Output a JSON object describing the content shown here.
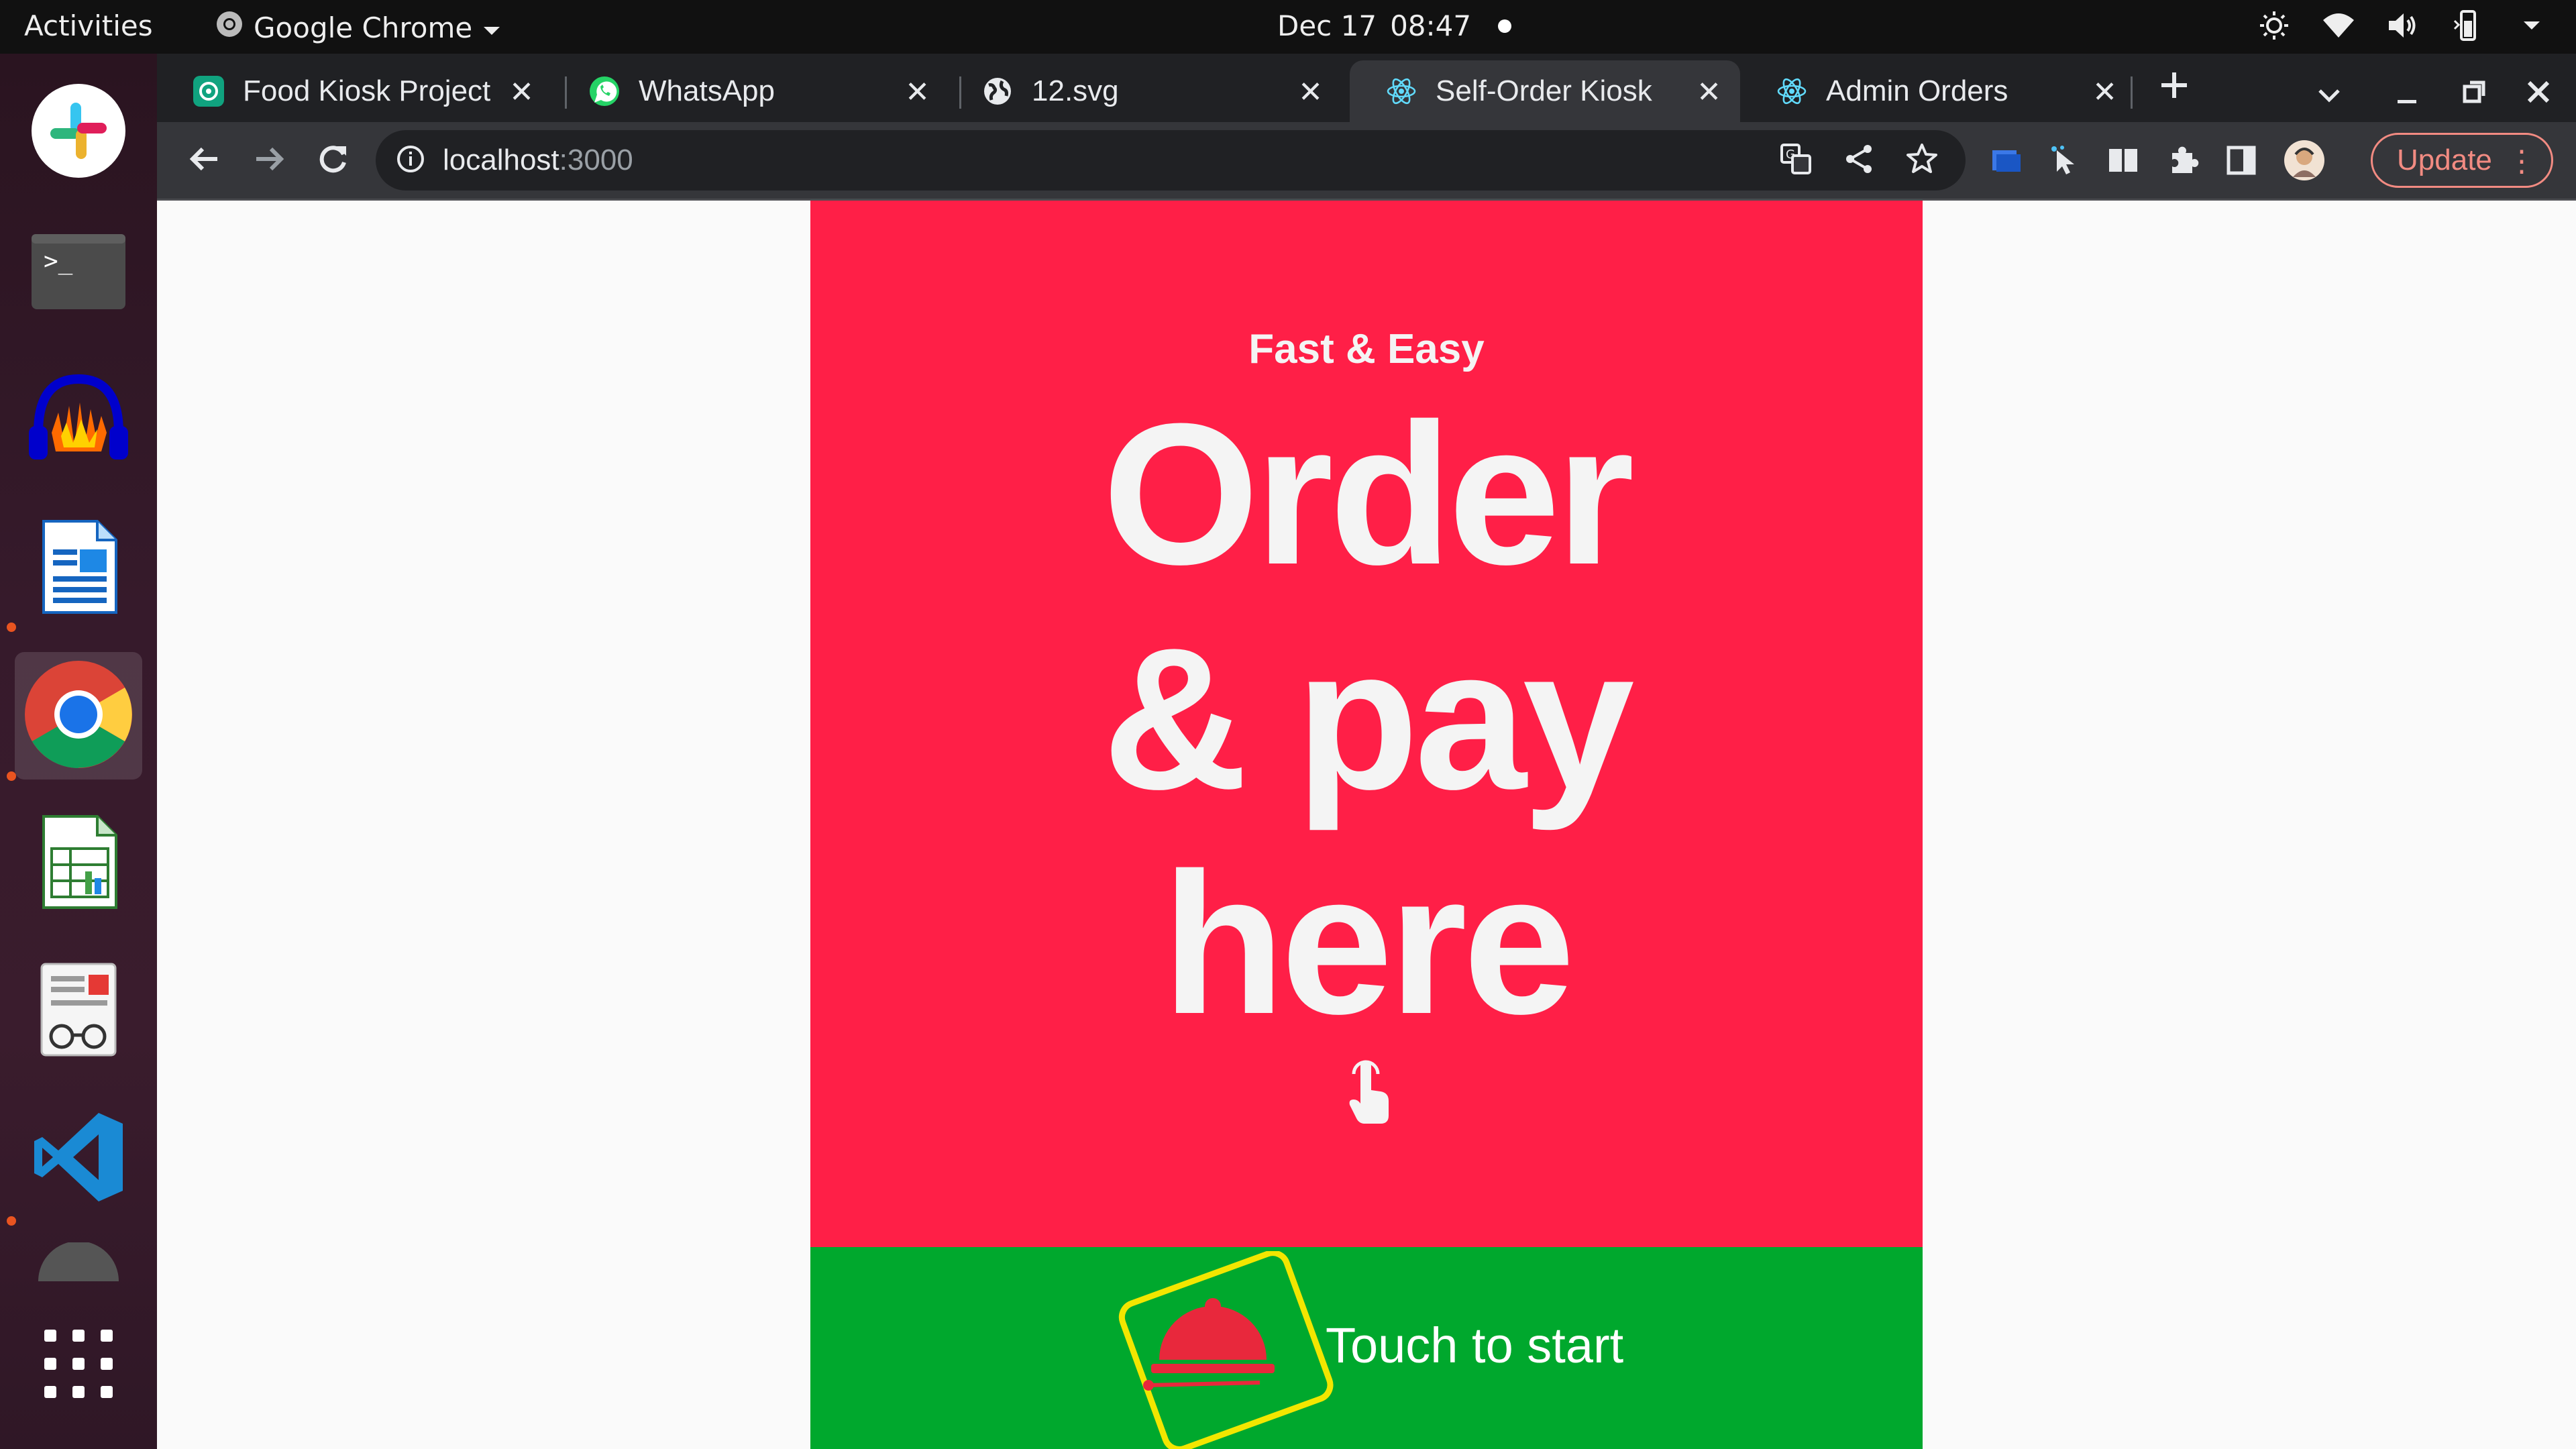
{
  "topbar": {
    "activities": "Activities",
    "app_name": "Google Chrome",
    "date": "Dec 17",
    "time": "08:47"
  },
  "dock": {
    "items": [
      {
        "name": "Slack",
        "icon": "slack-icon"
      },
      {
        "name": "Terminal",
        "icon": "terminal-icon"
      },
      {
        "name": "Audacity",
        "icon": "audacity-icon"
      },
      {
        "name": "LibreOffice Writer",
        "icon": "writer-icon"
      },
      {
        "name": "Google Chrome",
        "icon": "chrome-icon",
        "active": true
      },
      {
        "name": "LibreOffice Calc",
        "icon": "calc-icon"
      },
      {
        "name": "Document Viewer",
        "icon": "document-viewer-icon"
      },
      {
        "name": "Visual Studio Code",
        "icon": "vscode-icon"
      },
      {
        "name": "Show Applications",
        "icon": "app-grid-icon"
      }
    ]
  },
  "tabs": [
    {
      "title": "Food Kiosk Project",
      "icon": "chatgpt-icon"
    },
    {
      "title": "WhatsApp",
      "icon": "whatsapp-icon"
    },
    {
      "title": "12.svg",
      "icon": "globe-icon"
    },
    {
      "title": "Self-Order Kiosk",
      "icon": "react-icon",
      "active": true
    },
    {
      "title": "Admin Orders",
      "icon": "react-icon"
    }
  ],
  "toolbar": {
    "url_host": "localhost",
    "url_port": ":3000",
    "update_label": "Update"
  },
  "kiosk": {
    "tagline": "Fast & Easy",
    "headline": [
      "Order",
      "& pay",
      "here"
    ],
    "cta_label": "Touch to start"
  },
  "colors": {
    "hero_bg": "#ff1f47",
    "cta_bg": "#00a82d",
    "logo_border": "#f2e600"
  }
}
